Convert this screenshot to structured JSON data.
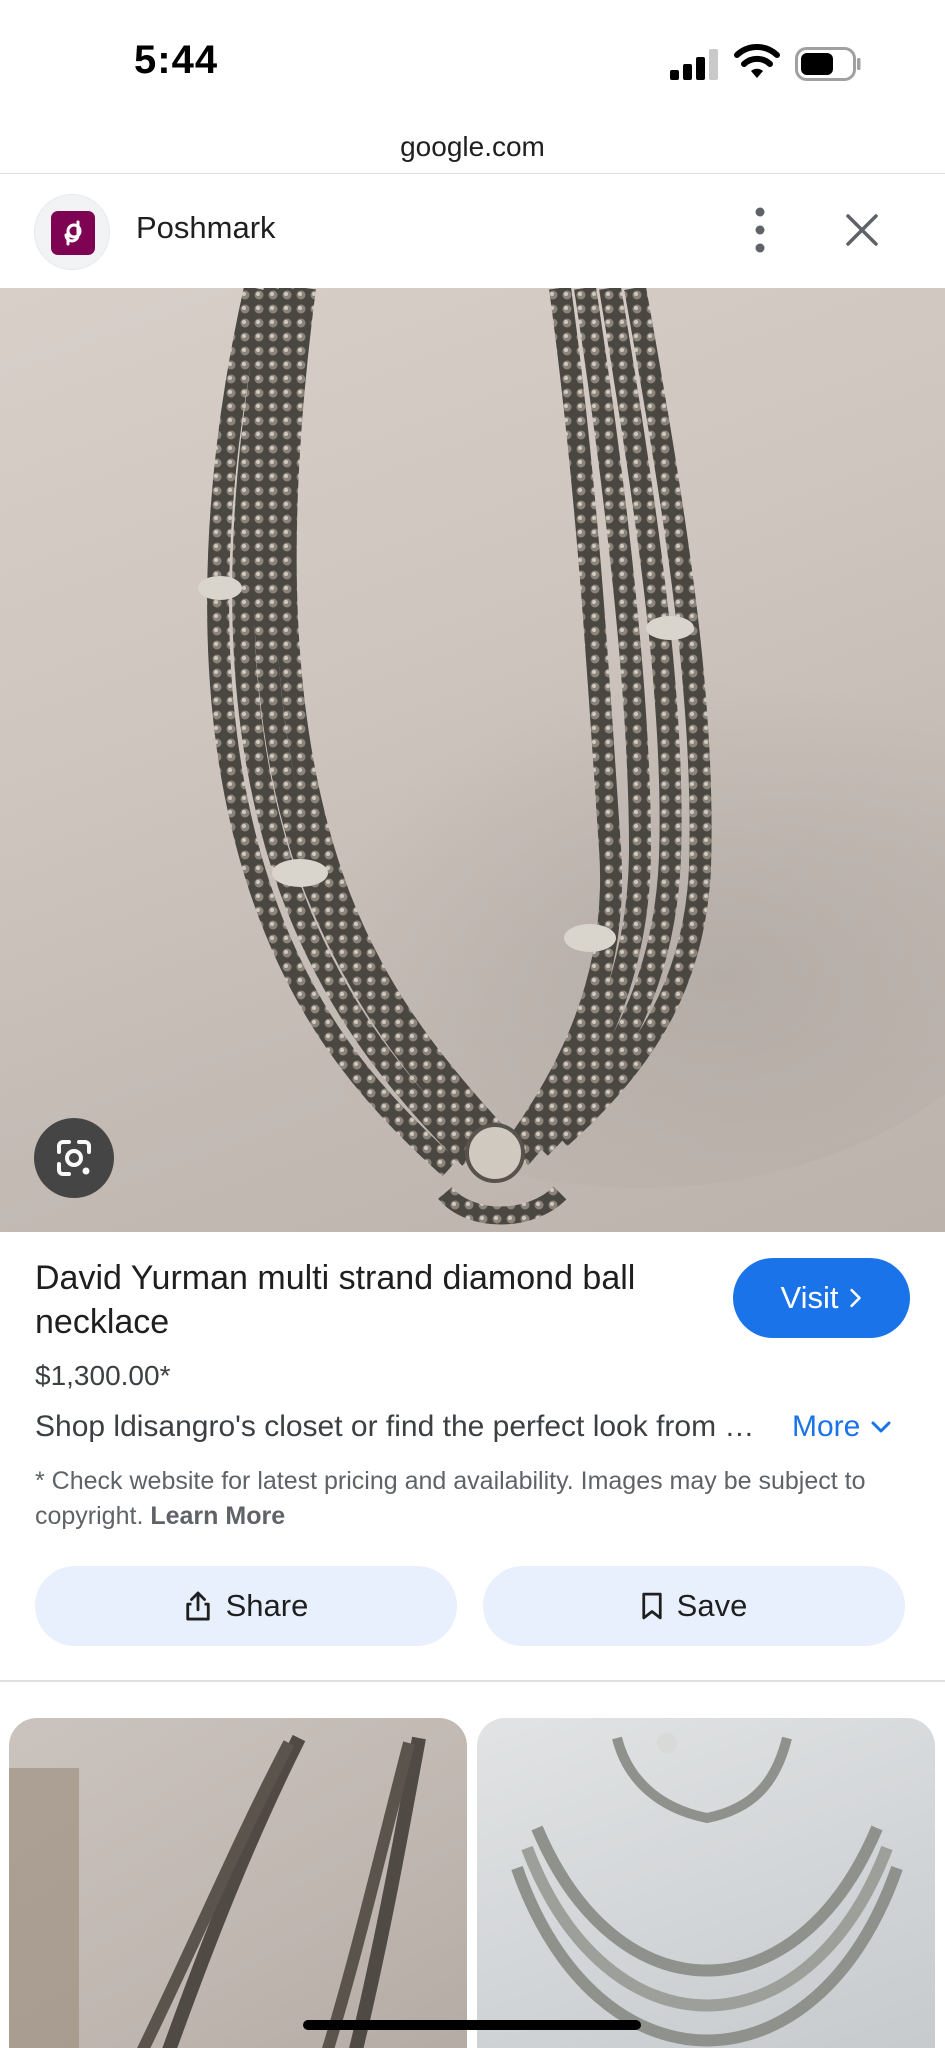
{
  "status_bar": {
    "time": "5:44"
  },
  "browser": {
    "url": "google.com"
  },
  "source": {
    "name": "Poshmark",
    "brand_color": "#7f0353"
  },
  "icons": {
    "source_logo": "poshmark-logo-icon",
    "menu": "more-vertical-icon",
    "close": "close-icon",
    "lens": "google-lens-icon",
    "visit_chevron": "chevron-right-icon",
    "more_chevron": "chevron-down-icon",
    "share": "share-icon",
    "save": "bookmark-icon"
  },
  "product": {
    "title": "David Yurman multi strand diamond ball necklace",
    "price": "$1,300.00*",
    "description": "Shop ldisangro's closet or find the perfect look from millions of stylists.",
    "more_label": "More",
    "disclaimer": "* Check website for latest pricing and availability. Images may be subject to copyright.",
    "learn_more_label": "Learn More"
  },
  "actions": {
    "visit_label": "Visit",
    "share_label": "Share",
    "save_label": "Save"
  },
  "colors": {
    "accent": "#1a73e8",
    "action_bg": "#e8f0fe"
  }
}
